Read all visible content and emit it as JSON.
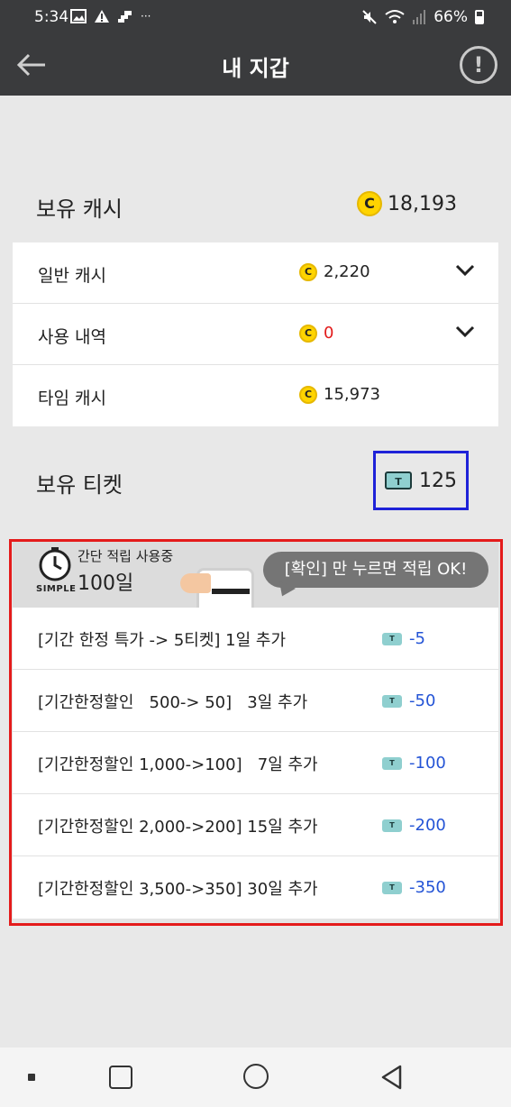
{
  "status": {
    "time": "5:34",
    "battery_percent": "66%",
    "icons": [
      "gallery-icon",
      "warning-icon",
      "app-icon",
      "more-icon",
      "mute-icon",
      "wifi-icon",
      "signal-icon",
      "battery-icon"
    ]
  },
  "appbar": {
    "title": "내 지갑",
    "info_glyph": "!"
  },
  "cash": {
    "heading": "보유 캐시",
    "total": "18,193",
    "coin_glyph": "C",
    "rows": [
      {
        "label": "일반 캐시",
        "value": "2,220",
        "expandable": true
      },
      {
        "label": "사용 내역",
        "value": "0",
        "expandable": true,
        "value_color": "#e21b1b"
      },
      {
        "label": "타임 캐시",
        "value": "15,973",
        "expandable": false
      }
    ]
  },
  "tickets": {
    "heading": "보유 티켓",
    "count": "125",
    "ticket_glyph": "T"
  },
  "promo": {
    "mode_label": "SIMPLE",
    "auto_label": "간단 적립 사용중",
    "days": "100일",
    "bubble": "[확인] 만 누르면 적립 OK!"
  },
  "offers": [
    {
      "label": "[기간 한정 특가 -> 5티켓] 1일 추가",
      "price": "-5"
    },
    {
      "label": "[기간한정할인   500-> 50]   3일 추가",
      "price": "-50"
    },
    {
      "label": "[기간한정할인 1,000->100]   7일 추가",
      "price": "-100"
    },
    {
      "label": "[기간한정할인 2,000->200] 15일 추가",
      "price": "-200"
    },
    {
      "label": "[기간한정할인 3,500->350] 30일 추가",
      "price": "-350"
    }
  ],
  "colors": {
    "appbar": "#3a3b3d",
    "coin": "#ffd400",
    "price_blue": "#2454d6",
    "highlight_red": "#e41b1b",
    "highlight_blue": "#1e22d8"
  }
}
